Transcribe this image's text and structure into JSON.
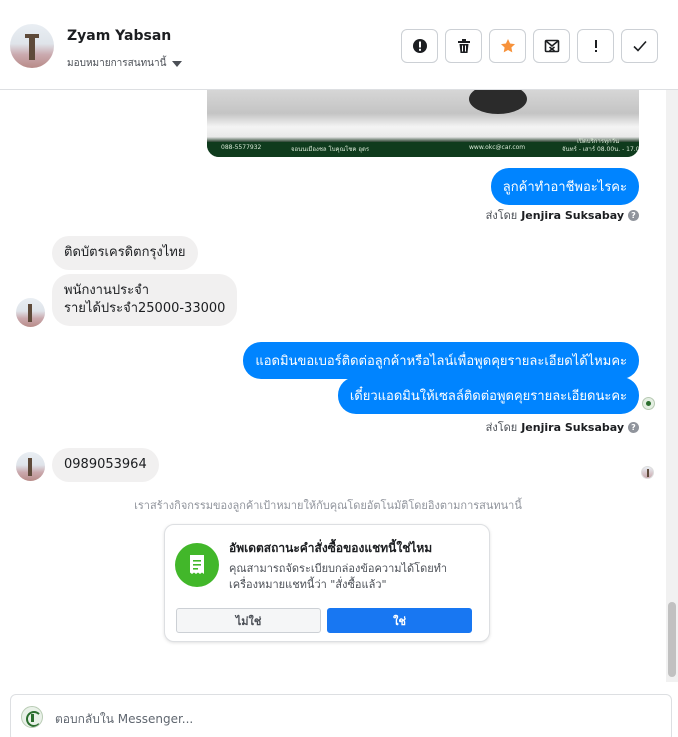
{
  "contact": {
    "name": "Zyam Yabsan",
    "assign_label": "มอบหมายการสนทนานี้"
  },
  "toolbar": {
    "buttons": [
      "alert-circle-icon",
      "trash-icon",
      "star-icon",
      "spam-icon",
      "exclamation-icon",
      "checkmark-icon"
    ],
    "star_color": "#f7923b"
  },
  "car_image": {
    "phone": "088-5577932",
    "page": "จอนนเมืองชล โบคุณโชค อุดร",
    "web": "www.okc@car.com",
    "hours_title": "เปิดบริการทุกวัน",
    "hours": "จันทร์ - เสาร์ 08.00น. - 17.00"
  },
  "messages": {
    "out_1": "ลูกค้าทำอาชีพอะไรคะ",
    "in_1": "ติดบัตรเครดิตกรุงไทย",
    "in_2_line1": "พนักงานประจำ",
    "in_2_line2": "รายได้ประจำ25000-33000",
    "out_2": "แอดมินขอเบอร์ติดต่อลูกค้าหรือไลน์เพื่อพูดคุยรายละเอียดได้ไหมคะ",
    "out_3": "เดี๋ยวแอดมินให้เซลล์ติดต่อพูดคุยรายละเอียดนะคะ",
    "in_3": "0989053964"
  },
  "sent_by": {
    "prefix": "ส่งโดย",
    "name": "Jenjira Suksabay"
  },
  "system_note": "เราสร้างกิจกรรมของลูกค้าเป้าหมายให้กับคุณโดยอัตโนมัติโดยอิงตามการสนทนานี้",
  "order_card": {
    "title": "อัพเดตสถานะคำสั่งซื้อของแชทนี้ใช่ไหม",
    "description": "คุณสามารถจัดระเบียบกล่องข้อความได้โดยทำเครื่องหมายแชทนี้ว่า \"สั่งซื้อแล้ว\"",
    "no_label": "ไม่ใช่",
    "yes_label": "ใช่",
    "accent": "#42b72a"
  },
  "reply": {
    "placeholder": "ตอบกลับใน Messenger..."
  },
  "colors": {
    "outgoing_bubble": "#0084ff",
    "incoming_bubble": "#f1f0f0",
    "primary_button": "#1877f2"
  }
}
